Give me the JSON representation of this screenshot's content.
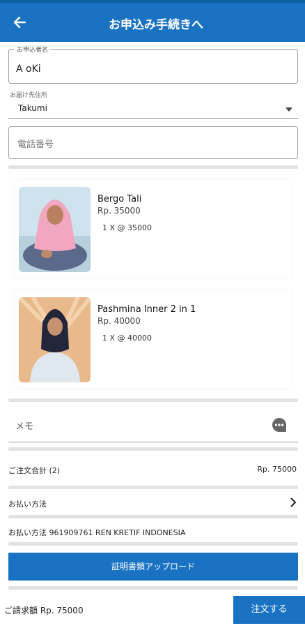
{
  "header": {
    "title": "お申込み手続きへ",
    "back_icon": "arrow-left-icon"
  },
  "form": {
    "name_label": "お申込者名",
    "name_value": "A oKi",
    "address_label": "お届け先住所",
    "address_value": "Takumi",
    "phone_placeholder": "電話番号"
  },
  "items": [
    {
      "name": "Bergo Tali",
      "price": "Rp. 35000",
      "qty": "1 X @ 35000"
    },
    {
      "name": "Pashmina Inner 2 in 1",
      "price": "Rp. 40000",
      "qty": "1 X @ 40000"
    }
  ],
  "memo": {
    "placeholder": "メモ",
    "icon": "chat-bubble-icon"
  },
  "summary": {
    "subtotal_label": "ご注文合計 (2)",
    "subtotal_value": "Rp. 75000",
    "payment_method_label": "お払い方法",
    "payment_detail": "お払い方法 961909761 REN KRETIF INDONESIA"
  },
  "upload_button": "証明書類アップロード",
  "footer": {
    "total_text": "ご請求額  Rp. 75000",
    "order_button": "注文する"
  },
  "colors": {
    "primary": "#1a73c2",
    "divider": "#e2e2e2"
  }
}
